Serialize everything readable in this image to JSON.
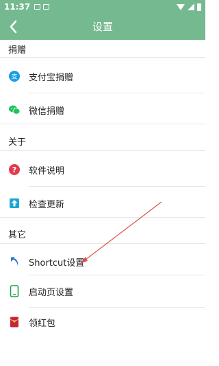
{
  "status_bar": {
    "time": "11:37"
  },
  "app_bar": {
    "title": "设置"
  },
  "sections": [
    {
      "header": "捐赠",
      "items": [
        {
          "label": "支付宝捐赠",
          "icon": "alipay-icon",
          "color": "#1a9ee6"
        },
        {
          "label": "微信捐赠",
          "icon": "wechat-icon",
          "color": "#22c35a"
        }
      ]
    },
    {
      "header": "关于",
      "items": [
        {
          "label": "软件说明",
          "icon": "help-icon",
          "color": "#e23b4c"
        },
        {
          "label": "检查更新",
          "icon": "update-icon",
          "color": "#1ba7d3"
        }
      ]
    },
    {
      "header": "其它",
      "items": [
        {
          "label": "Shortcut设置",
          "icon": "shortcut-arrow-icon",
          "color": "#1f6fd1"
        },
        {
          "label": "启动页设置",
          "icon": "phone-icon",
          "color": "#22a14a"
        },
        {
          "label": "领红包",
          "icon": "red-envelope-icon",
          "color": "#c8243a"
        }
      ]
    }
  ],
  "annotation": {
    "type": "arrow",
    "color": "#d9534f"
  }
}
